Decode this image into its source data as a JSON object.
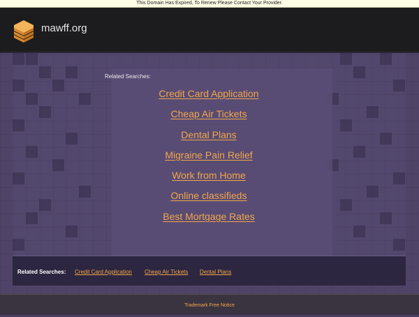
{
  "notice": "This Domain Has Expired, To Renew Please Contact Your Provider.",
  "header": {
    "site_name": "mawff.org",
    "logo_icon": "stacked-layers-icon",
    "logo_color": "#f0a64a"
  },
  "related": {
    "title": "Related Searches:",
    "links": [
      "Credit Card Application",
      "Cheap Air Tickets",
      "Dental Plans",
      "Migraine Pain Relief",
      "Work from Home",
      "Online classifieds",
      "Best Mortgage Rates"
    ]
  },
  "bottom": {
    "label": "Related Searches:",
    "links": [
      "Credit Card Application",
      "Cheap Air Tickets",
      "Dental Plans"
    ]
  },
  "footer": {
    "trademark": "Trademark Free Notice"
  },
  "colors": {
    "accent": "#f0a64a",
    "background": "#4f4468",
    "header": "#1c1c1e"
  }
}
